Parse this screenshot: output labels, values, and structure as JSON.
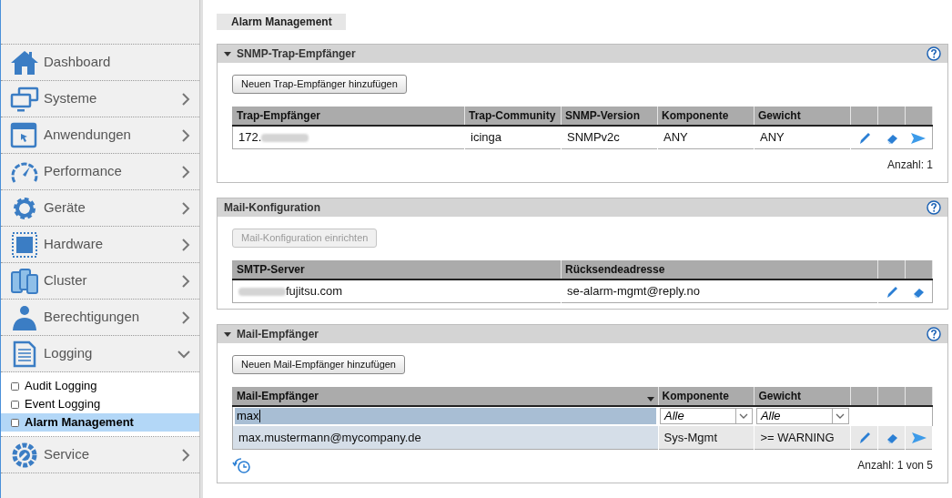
{
  "sidebar": {
    "items": [
      {
        "label": "Dashboard"
      },
      {
        "label": "Systeme",
        "expanded": false
      },
      {
        "label": "Anwendungen",
        "expanded": false
      },
      {
        "label": "Performance",
        "expanded": false
      },
      {
        "label": "Geräte",
        "expanded": false
      },
      {
        "label": "Hardware",
        "expanded": false
      },
      {
        "label": "Cluster",
        "expanded": false
      },
      {
        "label": "Berechtigungen",
        "expanded": false
      },
      {
        "label": "Logging",
        "expanded": true,
        "children": [
          {
            "label": "Audit Logging",
            "selected": false
          },
          {
            "label": "Event Logging",
            "selected": false
          },
          {
            "label": "Alarm Management",
            "selected": true
          }
        ]
      },
      {
        "label": "Service",
        "expanded": false
      }
    ]
  },
  "page_title": "Alarm Management",
  "panels": [
    {
      "title": "SNMP-Trap-Empfänger",
      "expanded": true,
      "button": {
        "label": "Neuen Trap-Empfänger hinzufügen",
        "disabled": false
      },
      "table": {
        "columns": [
          {
            "label": "Trap-Empfänger",
            "sorted": false
          },
          {
            "label": "Trap-Community",
            "sorted": false
          },
          {
            "label": "SNMP-Version",
            "sorted": false
          },
          {
            "label": "Komponente",
            "sorted": false
          },
          {
            "label": "Gewicht",
            "sorted": false
          }
        ],
        "rows": [
          {
            "cells": [
              "172.",
              "icinga",
              "SNMPv2c",
              "ANY",
              "ANY"
            ],
            "redacted_suffix": true,
            "highlighted": false,
            "actions": [
              {
                "kind": "edit"
              },
              {
                "kind": "erase"
              },
              {
                "kind": "send"
              }
            ]
          }
        ]
      },
      "count": "Anzahl: 1"
    },
    {
      "title": "Mail-Konfiguration",
      "button": {
        "label": "Mail-Konfiguration einrichten",
        "disabled": true
      },
      "table": {
        "columns": [
          {
            "label": "SMTP-Server",
            "sorted": false
          },
          {
            "label": "Rücksendeadresse",
            "sorted": false
          }
        ],
        "rows": [
          {
            "cells": [
              "fujitsu.com",
              "se-alarm-mgmt@reply.no"
            ],
            "redacted_prefix": true,
            "highlighted": false,
            "actions": [
              {
                "kind": "edit"
              },
              {
                "kind": "erase"
              }
            ]
          }
        ]
      }
    },
    {
      "title": "Mail-Empfänger",
      "expanded": true,
      "button": {
        "label": "Neuen Mail-Empfänger hinzufügen",
        "disabled": false
      },
      "table": {
        "columns": [
          {
            "label": "Mail-Empfänger",
            "sorted": true
          },
          {
            "label": "Komponente",
            "sorted": false
          },
          {
            "label": "Gewicht",
            "sorted": false
          }
        ],
        "filters": [
          {
            "kind": "text",
            "value": "max"
          },
          {
            "kind": "select",
            "value": "Alle"
          },
          {
            "kind": "select",
            "value": "Alle"
          }
        ],
        "rows": [
          {
            "cells": [
              "max.mustermann@mycompany.de",
              "Sys-Mgmt",
              ">= WARNING"
            ],
            "highlighted": true,
            "actions": [
              {
                "kind": "edit"
              },
              {
                "kind": "erase"
              },
              {
                "kind": "send"
              }
            ]
          }
        ]
      },
      "count": "Anzahl: 1 von 5",
      "refresh": true
    }
  ]
}
